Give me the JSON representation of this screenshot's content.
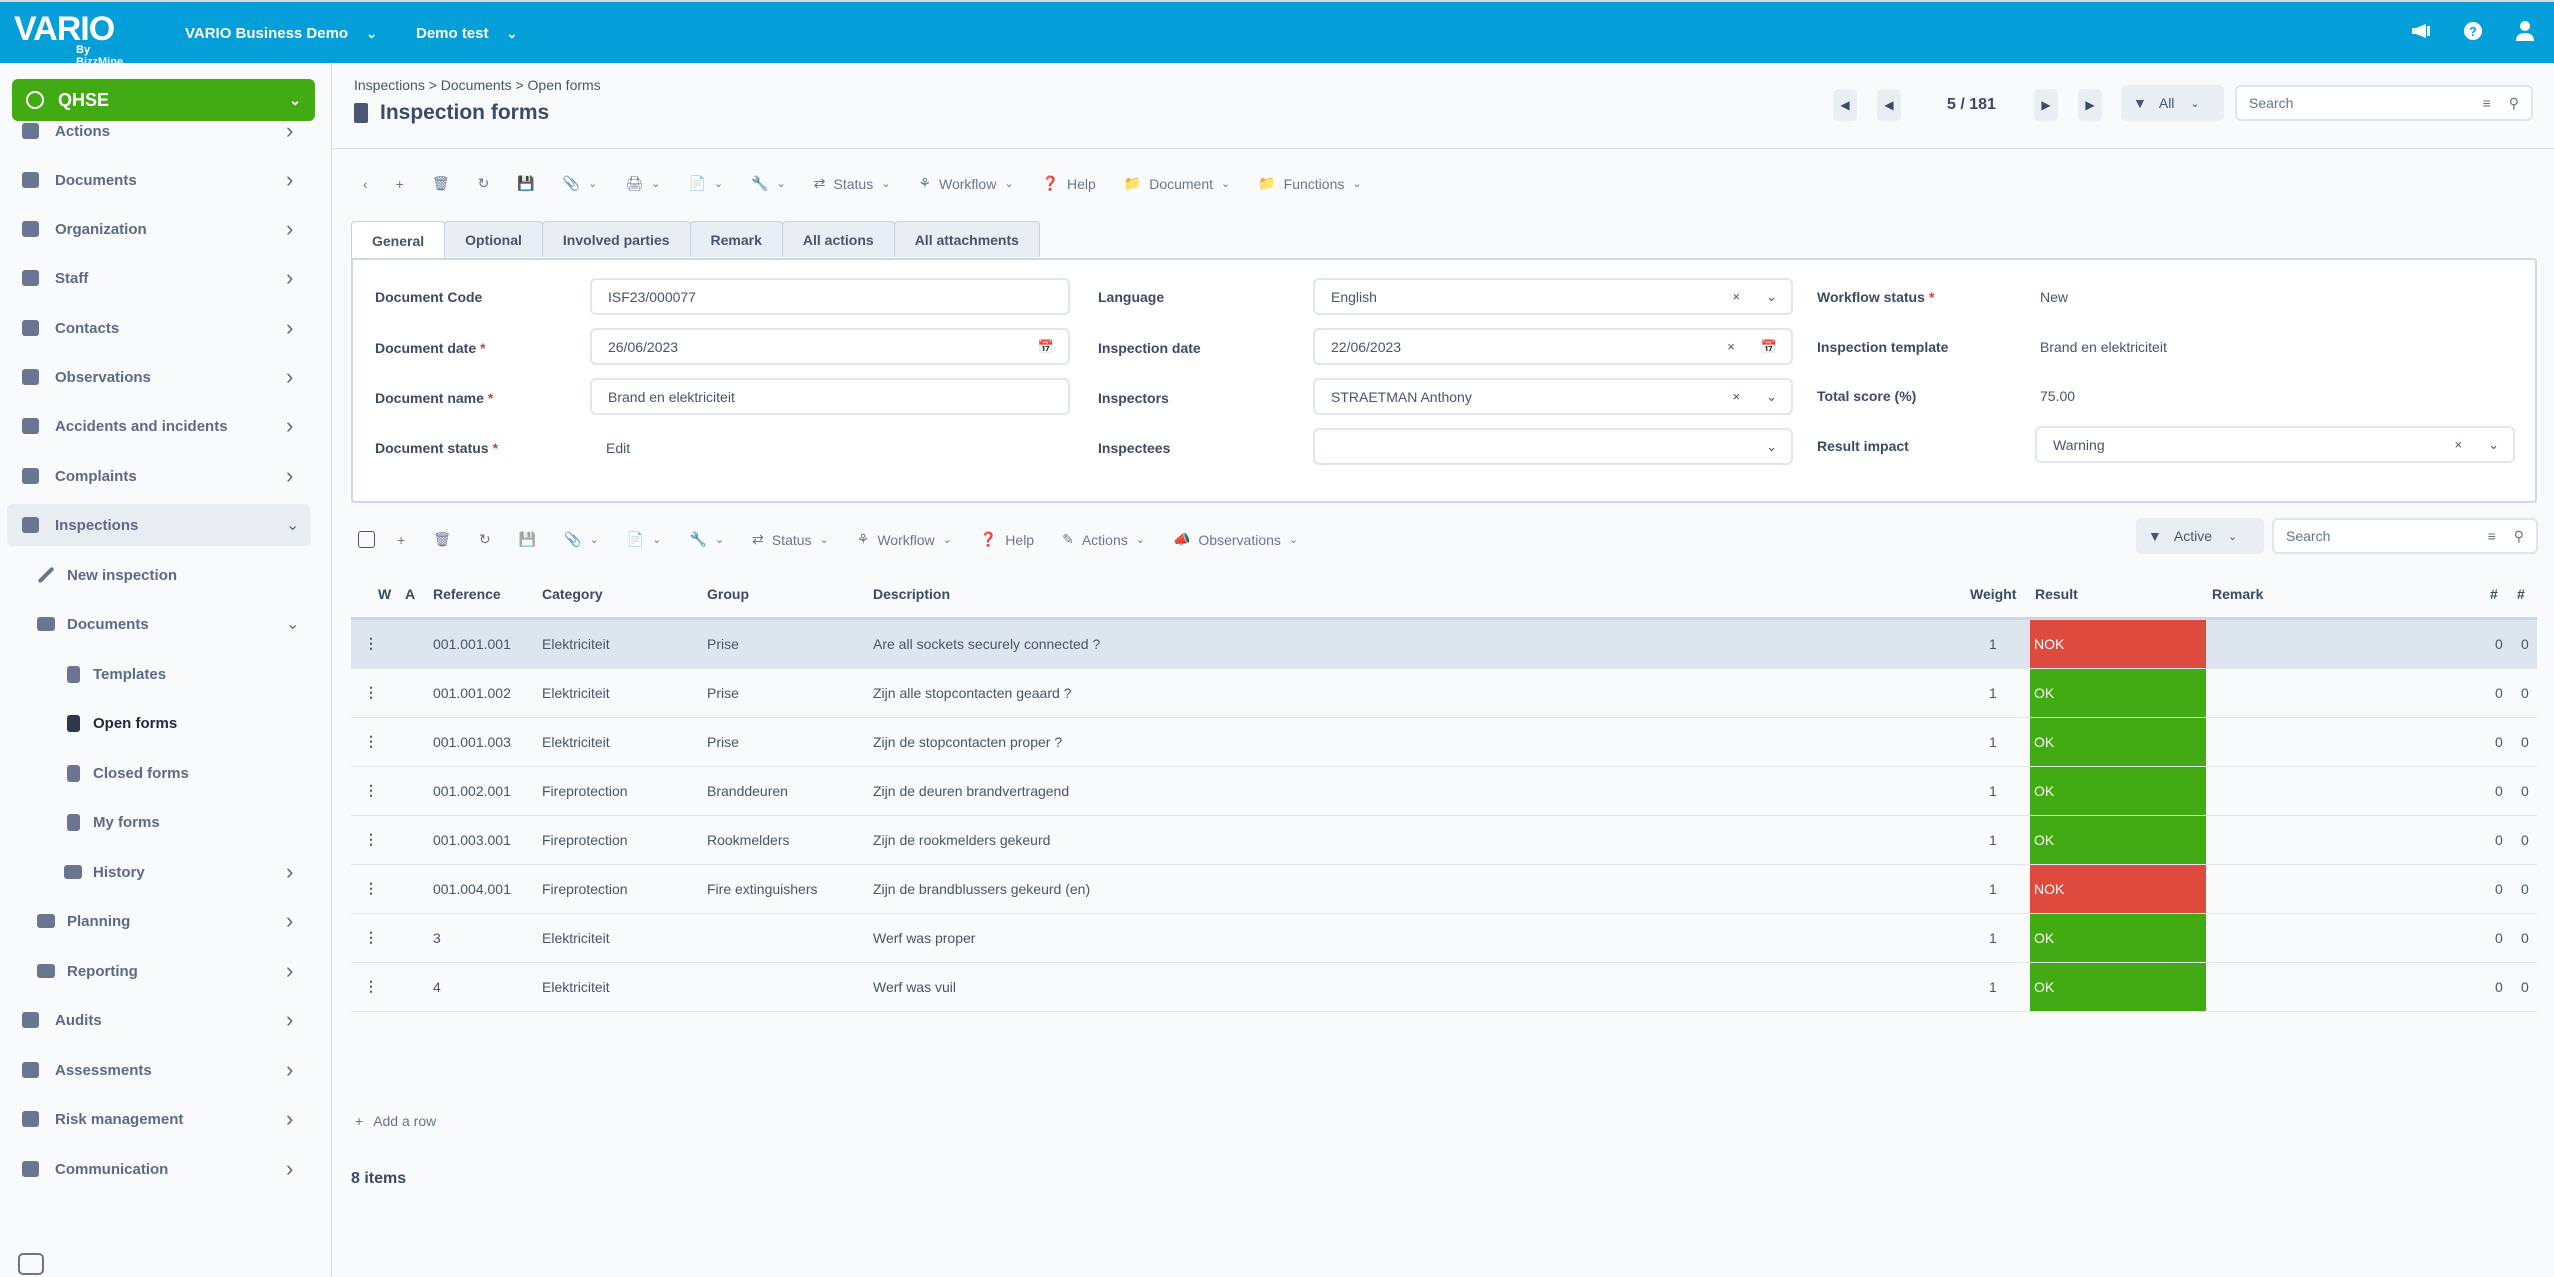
{
  "topbar": {
    "logo_text": "VARIO",
    "logo_sub": "By BizzMine",
    "env_label": "VARIO Business Demo",
    "db_label": "Demo test",
    "icons": [
      "megaphone-icon",
      "help-icon",
      "user-icon"
    ]
  },
  "sidebar": {
    "module": "QHSE",
    "items": [
      {
        "label": "Actions",
        "icon": "actions-icon"
      },
      {
        "label": "Documents",
        "icon": "book-icon"
      },
      {
        "label": "Organization",
        "icon": "sitemap-icon"
      },
      {
        "label": "Staff",
        "icon": "users-icon"
      },
      {
        "label": "Contacts",
        "icon": "address-book-icon"
      },
      {
        "label": "Observations",
        "icon": "megaphone-icon"
      },
      {
        "label": "Accidents and incidents",
        "icon": "ambulance-icon"
      },
      {
        "label": "Complaints",
        "icon": "frown-icon"
      },
      {
        "label": "Inspections",
        "icon": "checkbox-icon"
      },
      {
        "label": "New inspection",
        "icon": "pencil-icon"
      },
      {
        "label": "Documents",
        "icon": "folder-icon"
      },
      {
        "label": "Templates",
        "icon": "file-icon"
      },
      {
        "label": "Open forms",
        "icon": "file-icon"
      },
      {
        "label": "Closed forms",
        "icon": "file-icon"
      },
      {
        "label": "My forms",
        "icon": "file-icon"
      },
      {
        "label": "History",
        "icon": "folder-icon"
      },
      {
        "label": "Planning",
        "icon": "folder-icon"
      },
      {
        "label": "Reporting",
        "icon": "folder-icon"
      },
      {
        "label": "Audits",
        "icon": "calendar-check-icon"
      },
      {
        "label": "Assessments",
        "icon": "chart-line-icon"
      },
      {
        "label": "Risk management",
        "icon": "shield-icon"
      },
      {
        "label": "Communication",
        "icon": "users-icon"
      }
    ]
  },
  "header": {
    "breadcrumb": "Inspections > Documents > Open forms",
    "title": "Inspection forms",
    "pager": "5 / 181",
    "filter": "All",
    "search_placeholder": "Search"
  },
  "toolbar": {
    "status": "Status",
    "workflow": "Workflow",
    "help": "Help",
    "document": "Document",
    "functions": "Functions"
  },
  "tabs": [
    "General",
    "Optional",
    "Involved parties",
    "Remark",
    "All actions",
    "All attachments"
  ],
  "form": {
    "document_code": {
      "label": "Document Code",
      "value": "ISF23/000077"
    },
    "document_date": {
      "label": "Document date",
      "value": "26/06/2023"
    },
    "document_name": {
      "label": "Document name",
      "value": "Brand en elektriciteit"
    },
    "document_status": {
      "label": "Document status",
      "value": "Edit"
    },
    "language": {
      "label": "Language",
      "value": "English"
    },
    "inspection_date": {
      "label": "Inspection date",
      "value": "22/06/2023"
    },
    "inspectors": {
      "label": "Inspectors",
      "value": "STRAETMAN Anthony"
    },
    "inspectees": {
      "label": "Inspectees",
      "value": ""
    },
    "workflow_status": {
      "label": "Workflow status",
      "value": "New"
    },
    "inspection_template": {
      "label": "Inspection template",
      "value": "Brand en elektriciteit"
    },
    "total_score": {
      "label": "Total score (%)",
      "value": "75.00"
    },
    "result_impact": {
      "label": "Result impact",
      "value": "Warning"
    }
  },
  "grid_toolbar": {
    "status": "Status",
    "workflow": "Workflow",
    "help": "Help",
    "actions": "Actions",
    "observations": "Observations",
    "filter": "Active",
    "search_placeholder": "Search"
  },
  "table": {
    "columns": [
      "W",
      "A",
      "Reference",
      "Category",
      "Group",
      "Description",
      "Weight",
      "Result",
      "Remark",
      "#",
      "#"
    ],
    "rows": [
      {
        "reference": "001.001.001",
        "category": "Elektriciteit",
        "group": "Prise",
        "description": "Are all sockets securely connected ?",
        "weight": "1",
        "result": "NOK",
        "remark": "",
        "c1": "0",
        "c2": "0"
      },
      {
        "reference": "001.001.002",
        "category": "Elektriciteit",
        "group": "Prise",
        "description": "Zijn alle stopcontacten geaard ?",
        "weight": "1",
        "result": "OK",
        "remark": "",
        "c1": "0",
        "c2": "0"
      },
      {
        "reference": "001.001.003",
        "category": "Elektriciteit",
        "group": "Prise",
        "description": "Zijn de stopcontacten proper ?",
        "weight": "1",
        "result": "OK",
        "remark": "",
        "c1": "0",
        "c2": "0"
      },
      {
        "reference": "001.002.001",
        "category": "Fireprotection",
        "group": "Branddeuren",
        "description": "Zijn de deuren brandvertragend",
        "weight": "1",
        "result": "OK",
        "remark": "",
        "c1": "0",
        "c2": "0"
      },
      {
        "reference": "001.003.001",
        "category": "Fireprotection",
        "group": "Rookmelders",
        "description": "Zijn de rookmelders gekeurd",
        "weight": "1",
        "result": "OK",
        "remark": "",
        "c1": "0",
        "c2": "0"
      },
      {
        "reference": "001.004.001",
        "category": "Fireprotection",
        "group": "Fire extinguishers",
        "description": "Zijn de brandblussers gekeurd (en)",
        "weight": "1",
        "result": "NOK",
        "remark": "",
        "c1": "0",
        "c2": "0"
      },
      {
        "reference": "3",
        "category": "Elektriciteit",
        "group": "",
        "description": "Werf was proper",
        "weight": "1",
        "result": "OK",
        "remark": "",
        "c1": "0",
        "c2": "0"
      },
      {
        "reference": "4",
        "category": "Elektriciteit",
        "group": "",
        "description": "Werf was vuil",
        "weight": "1",
        "result": "OK",
        "remark": "",
        "c1": "0",
        "c2": "0"
      }
    ],
    "add_row": "Add a row",
    "item_count": "8 items"
  },
  "colors": {
    "topbar": "#049fd9",
    "module": "#42ab14",
    "ok": "#42ab14",
    "nok": "#df4a3e"
  }
}
